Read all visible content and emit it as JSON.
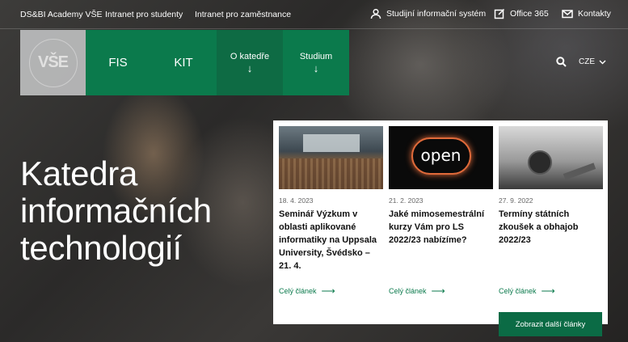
{
  "topbar": {
    "links": [
      "DS&BI Academy VŠE",
      "Intranet pro studenty",
      "Intranet pro zaměstnance"
    ],
    "tools": [
      {
        "label": "Studijní informační systém",
        "icon": "user-icon"
      },
      {
        "label": "Office 365",
        "icon": "edit-icon"
      },
      {
        "label": "Kontakty",
        "icon": "mail-icon"
      }
    ]
  },
  "nav": {
    "logo_text": "VŠE",
    "items": [
      "FIS",
      "KIT",
      "O katedře",
      "Studium"
    ],
    "arrow": "↓",
    "lang": "CZE"
  },
  "hero": {
    "title_lines": [
      "Katedra",
      "informačních",
      "technologií"
    ]
  },
  "news": [
    {
      "date": "18. 4. 2023",
      "title": "Seminář Výzkum v oblasti aplikované informatiky na Uppsala University, Švédsko – 21. 4.",
      "more": "Celý článek"
    },
    {
      "date": "21. 2. 2023",
      "title": "Jaké mimosemestrální kurzy Vám pro LS 2022/23 nabízíme?",
      "more": "Celý článek"
    },
    {
      "date": "27. 9. 2022",
      "title": "Termíny státních zkoušek a obhajob 2022/23",
      "more": "Celý článek"
    }
  ],
  "news_button": "Zobrazit další články",
  "colors": {
    "brand_green": "#0b7a4c",
    "brand_green_dark": "#0b6b45"
  }
}
